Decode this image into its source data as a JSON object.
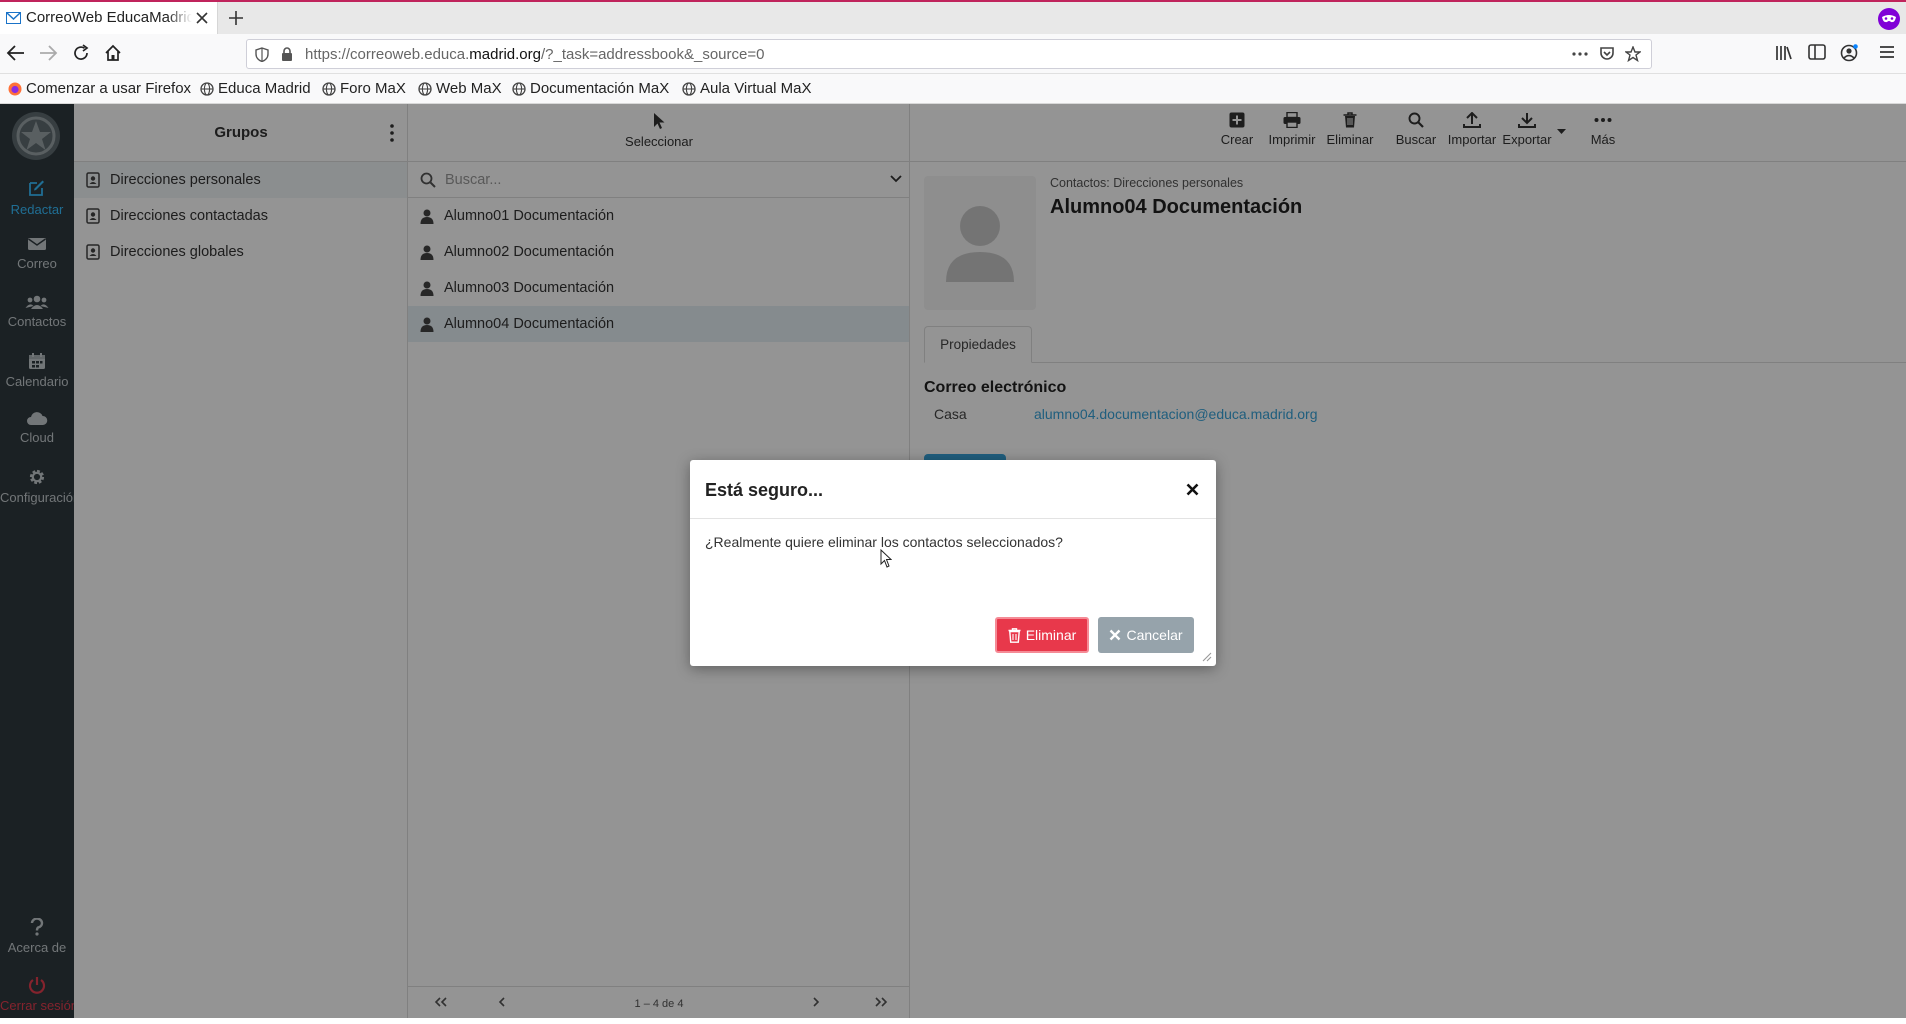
{
  "browser": {
    "tab_title": "CorreoWeb EducaMadrid",
    "url_prefix": "https://correoweb.educa.",
    "url_domain": "madrid.org",
    "url_rest": "/?_task=addressbook&_source=0",
    "bookmarks": [
      "Comenzar a usar Firefox",
      "Educa Madrid",
      "Foro MaX",
      "Web MaX",
      "Documentación MaX",
      "Aula Virtual MaX"
    ]
  },
  "nav": {
    "items": [
      {
        "label": "Redactar",
        "icon": "compose-icon"
      },
      {
        "label": "Correo",
        "icon": "mail-icon"
      },
      {
        "label": "Contactos",
        "icon": "users-icon"
      },
      {
        "label": "Calendario",
        "icon": "calendar-icon"
      },
      {
        "label": "Cloud",
        "icon": "cloud-icon"
      },
      {
        "label": "Configuración",
        "icon": "gear-icon"
      }
    ],
    "about": "Acerca de",
    "logout": "Cerrar sesión",
    "accent_color": "#37beff",
    "logout_color": "#e33d4f"
  },
  "groups": {
    "title": "Grupos",
    "items": [
      "Direcciones personales",
      "Direcciones contactadas",
      "Direcciones globales"
    ]
  },
  "contacts": {
    "select_label": "Seleccionar",
    "search_placeholder": "Buscar...",
    "items": [
      "Alumno01 Documentación",
      "Alumno02 Documentación",
      "Alumno03 Documentación",
      "Alumno04 Documentación"
    ],
    "pagination": "1 – 4 de 4"
  },
  "toolbar": {
    "create": "Crear",
    "print": "Imprimir",
    "delete": "Eliminar",
    "search": "Buscar",
    "import": "Importar",
    "export": "Exportar",
    "more": "Más"
  },
  "detail": {
    "breadcrumb": "Contactos: Direcciones personales",
    "name": "Alumno04 Documentación",
    "tab": "Propiedades",
    "section": "Correo electrónico",
    "email_label": "Casa",
    "email_value": "alumno04.documentacion@educa.madrid.org"
  },
  "dialog": {
    "title": "Está seguro...",
    "message": "¿Realmente quiere eliminar los contactos seleccionados?",
    "confirm": "Eliminar",
    "cancel": "Cancelar",
    "danger_color": "#e8384b"
  }
}
